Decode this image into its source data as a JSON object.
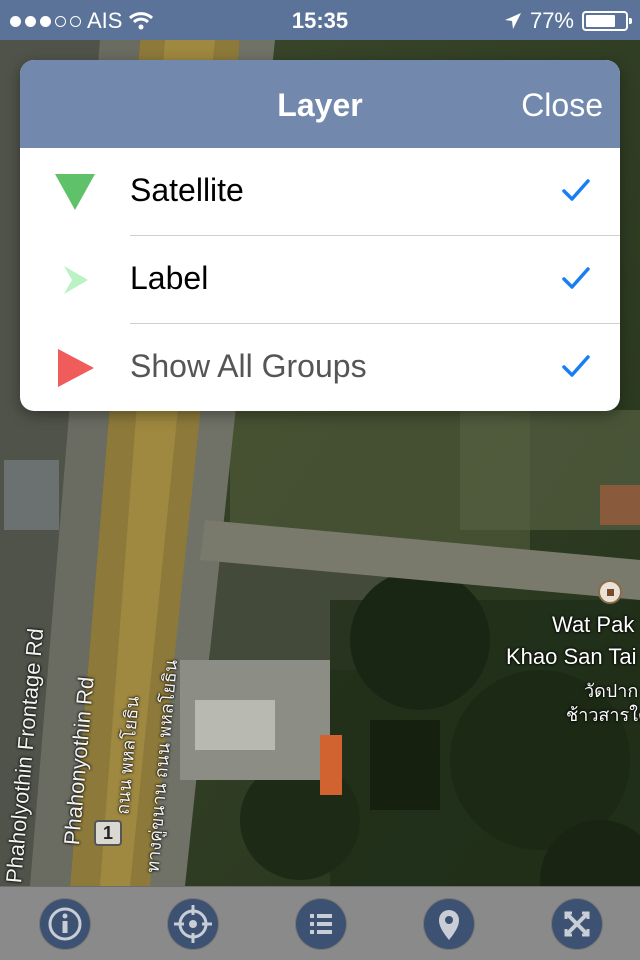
{
  "status_bar": {
    "carrier": "AIS",
    "time": "15:35",
    "battery": "77%",
    "battery_level": 0.77,
    "signal_bars_filled": 3,
    "signal_bars_total": 5
  },
  "layer_panel": {
    "title": "Layer",
    "close_label": "Close",
    "items": [
      {
        "label": "Satellite",
        "icon": "triangle-down-icon",
        "icon_color": "#5fc26a",
        "checked": true
      },
      {
        "label": "Label",
        "icon": "chevron-right-icon",
        "icon_color": "#b9f2c3",
        "checked": true
      },
      {
        "label": "Show All Groups",
        "icon": "triangle-right-icon",
        "icon_color": "#f05c5c",
        "checked": true
      }
    ],
    "check_color": "#1a7ef2"
  },
  "map": {
    "labels": {
      "place_en_1": "Wat Pak",
      "place_en_2": "Khao San Tai",
      "place_th_1": "วัดปาก",
      "place_th_2": "ช้าวสารใต้",
      "road_frontage": "Phaholyothin Frontage Rd",
      "road_main": "Phahonyothin Rd",
      "road_th_1": "ถนน พหลโยธิน",
      "road_th_2": "ทางคู่ขนาน ถนน พหลโยธิน",
      "route_marker": "1"
    }
  },
  "toolbar": {
    "buttons": [
      {
        "name": "info-icon"
      },
      {
        "name": "crosshair-icon"
      },
      {
        "name": "list-icon"
      },
      {
        "name": "map-pin-icon"
      },
      {
        "name": "collapse-icon"
      }
    ]
  }
}
